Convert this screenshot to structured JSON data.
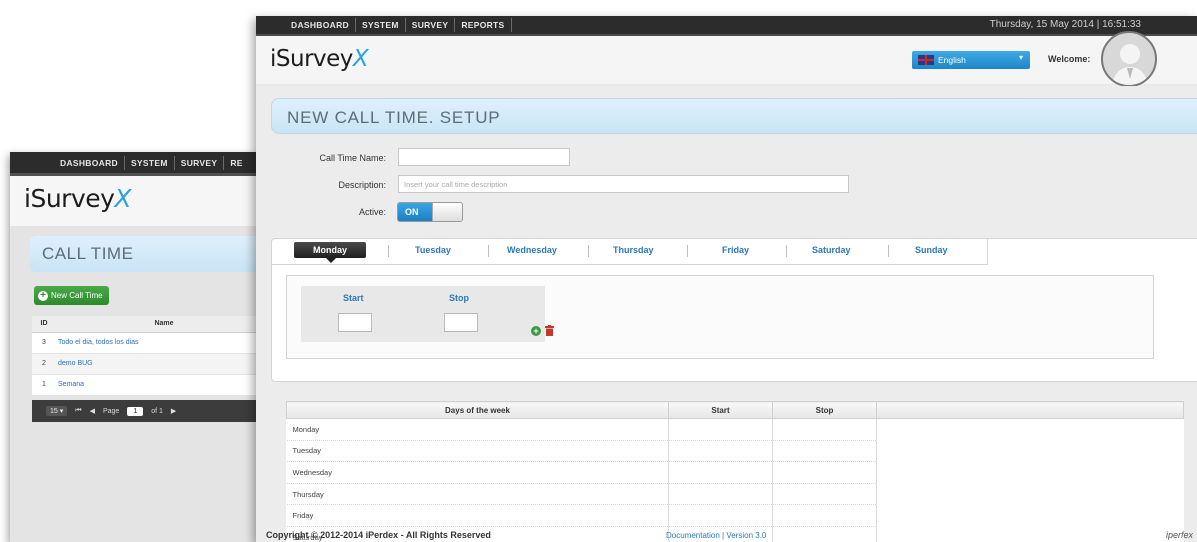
{
  "back_window": {
    "menu": [
      "DASHBOARD",
      "SYSTEM",
      "SURVEY",
      "RE"
    ],
    "logo": {
      "text": "iSurvey",
      "accent": "X"
    },
    "panel_title": "CALL TIME",
    "new_button_label": "New Call Time",
    "table": {
      "headers": [
        "ID",
        "Name"
      ],
      "rows": [
        {
          "id": "3",
          "name": "Todo el dia, todos los dias"
        },
        {
          "id": "2",
          "name": "demo BUG"
        },
        {
          "id": "1",
          "name": "Semana"
        }
      ]
    },
    "pager": {
      "page_size": "15",
      "page_label": "Page",
      "page_value": "1",
      "of_label": "of 1"
    }
  },
  "front_window": {
    "menu": [
      "DASHBOARD",
      "SYSTEM",
      "SURVEY",
      "REPORTS"
    ],
    "datetime": "Thursday, 15 May 2014 | 16:51:33",
    "logo": {
      "text": "iSurvey",
      "accent": "X"
    },
    "language": "English",
    "welcome": "Welcome:",
    "panel_title": "NEW CALL TIME. SETUP",
    "form": {
      "name_label": "Call Time Name:",
      "description_label": "Description:",
      "description_placeholder": "Insert your call time description",
      "active_label": "Active:",
      "toggle_on": "ON"
    },
    "tabs": [
      "Monday",
      "Tuesday",
      "Wednesday",
      "Thursday",
      "Friday",
      "Saturday",
      "Sunday"
    ],
    "active_tab": "Monday",
    "start_label": "Start",
    "stop_label": "Stop",
    "days_table": {
      "headers": [
        "Days of the week",
        "Start",
        "Stop",
        ""
      ],
      "rows": [
        "Monday",
        "Tuesday",
        "Wednesday",
        "Thursday",
        "Friday",
        "Saturday"
      ]
    },
    "footer": {
      "copyright": "Copyright © 2012-2014 iPerdex - All Rights Reserved",
      "documentation": "Documentation | Version 3.0",
      "brand": "iperfex"
    }
  },
  "colors": {
    "accent_blue": "#2aa4dc",
    "link_blue": "#2a7ab8",
    "topbar": "#2c2c2c",
    "green": "#2b8a2c"
  }
}
